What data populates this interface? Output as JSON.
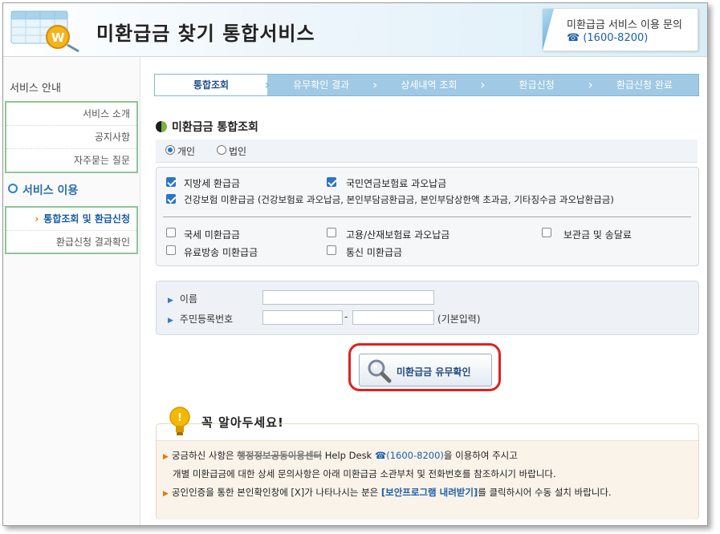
{
  "header": {
    "title": "미환급금 찾기 통합서비스",
    "contact_label": "미환급금 서비스 이용 문의",
    "contact_phone": "☎ (1600-8200)"
  },
  "sidebar": {
    "section1_title": "서비스 안내",
    "section1_items": [
      "서비스 소개",
      "공지사항",
      "자주묻는 질문"
    ],
    "section2_title": "서비스 이용",
    "section2_items": [
      "통합조회 및 환급신청",
      "환급신청 결과확인"
    ],
    "active_arrow": "›"
  },
  "steps": [
    "통합조회",
    "유무확인 결과",
    "상세내역 조회",
    "환급신청",
    "환급신청 완료"
  ],
  "section_title": "미환급금 통합조회",
  "person_type": {
    "options": [
      "개인",
      "법인"
    ],
    "selected": "개인"
  },
  "checkboxes": {
    "group1": [
      {
        "label": "지방세 환급금",
        "checked": true
      },
      {
        "label": "국민연금보험료 과오납금",
        "checked": true
      },
      {
        "label": "건강보험 미환급금 (건강보험료 과오납금, 본인부담금환급금, 본인부담상한액 초과금, 기타징수금 과오납환급금)",
        "checked": true
      }
    ],
    "group2": [
      {
        "label": "국세 미환급금",
        "checked": false
      },
      {
        "label": "고용/산재보험료 과오납금",
        "checked": false
      },
      {
        "label": "보관금 및 송달료",
        "checked": false
      },
      {
        "label": "유료방송 미환급금",
        "checked": false
      },
      {
        "label": "통신 미환급금",
        "checked": false
      }
    ]
  },
  "form": {
    "name_label": "이름",
    "name_value": "",
    "rrn_label": "주민등록번호",
    "rrn_front_value": "",
    "rrn_back_value": "",
    "rrn_dash": "-",
    "rrn_hint": "(기본입력)"
  },
  "check_button_label": "미환급금 유무확인",
  "notice": {
    "title": "꼭 알아두세요!",
    "line1_pre": "궁금하신 사항은",
    "line1_org": "행정정보공동이용센터",
    "line1_desk": "Help Desk",
    "line1_phone": "(1600-8200)",
    "line1_post": "을 이용하여 주시고",
    "line2": "개별 미환급금에 대한 상세 문의사항은 아래 미환급금 소관부처 및 전화번호를 참조하시기 바랍니다.",
    "line3_pre": "공인인증을 통한 본인확인창에 [X]가 나타나시는 분은",
    "line3_link": "[보안프로그램 내려받기]",
    "line3_post": "를 클릭하시어 수동 설치 바랍니다."
  },
  "colors": {
    "accent": "#2a76c6",
    "step_bar": "#9fc9e4",
    "highlight_ring": "#e02020",
    "sidebar_border": "#8fc49b"
  }
}
